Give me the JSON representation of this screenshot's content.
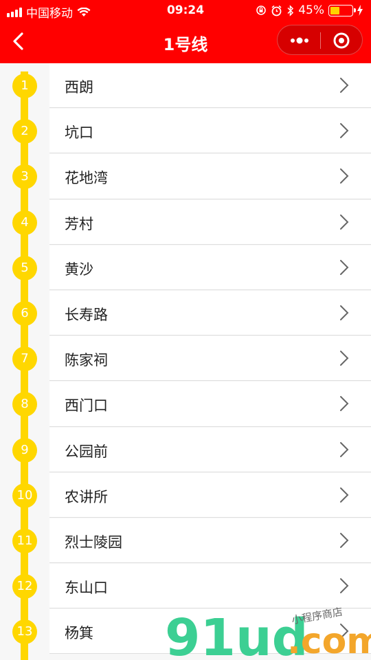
{
  "status_bar": {
    "carrier": "中国移动",
    "time": "09:24",
    "battery": "45%"
  },
  "nav": {
    "title": "1号线"
  },
  "colors": {
    "brand": "#ff0000",
    "line": "#ffd700"
  },
  "stations": [
    {
      "num": "1",
      "name": "西朗"
    },
    {
      "num": "2",
      "name": "坑口"
    },
    {
      "num": "3",
      "name": "花地湾"
    },
    {
      "num": "4",
      "name": "芳村"
    },
    {
      "num": "5",
      "name": "黄沙"
    },
    {
      "num": "6",
      "name": "长寿路"
    },
    {
      "num": "7",
      "name": "陈家祠"
    },
    {
      "num": "8",
      "name": "西门口"
    },
    {
      "num": "9",
      "name": "公园前"
    },
    {
      "num": "10",
      "name": "农讲所"
    },
    {
      "num": "11",
      "name": "烈士陵园"
    },
    {
      "num": "12",
      "name": "东山口"
    },
    {
      "num": "13",
      "name": "杨箕"
    }
  ],
  "watermark": {
    "main": "91ud",
    "dot": ".com",
    "sub": "小程序商店"
  }
}
